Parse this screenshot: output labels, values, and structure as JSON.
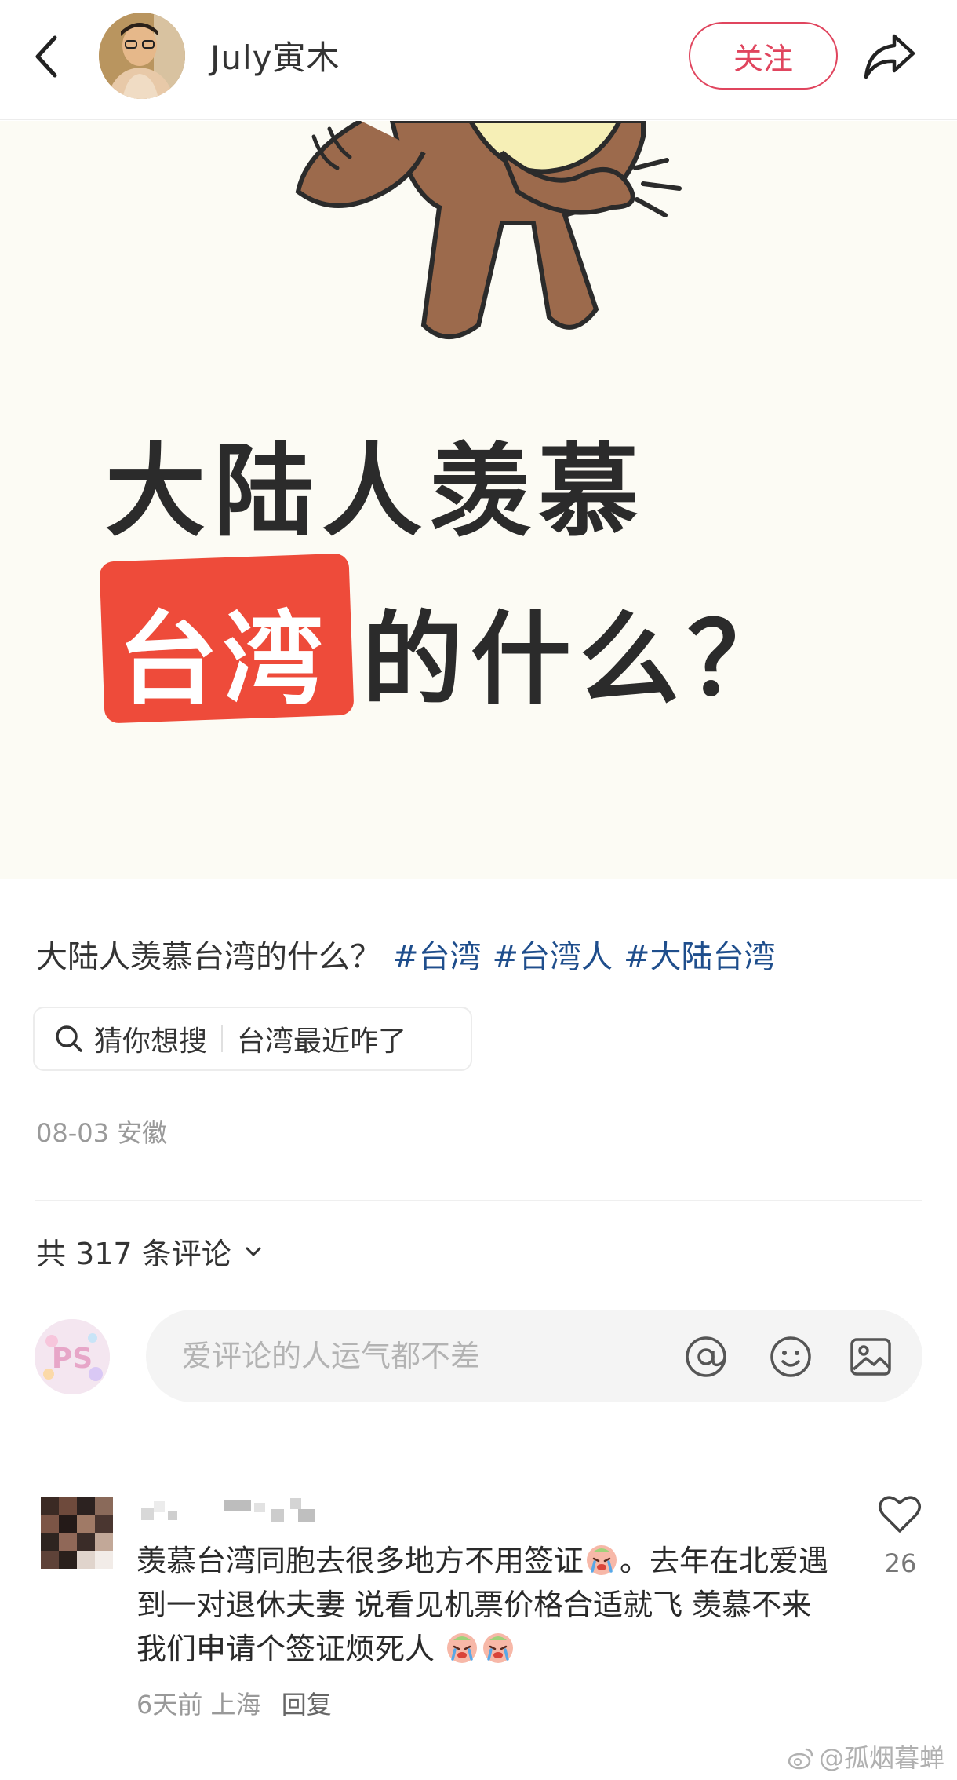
{
  "header": {
    "author_name": "July寅木",
    "follow_label": "关注"
  },
  "cover": {
    "line1": "大陆人羡慕",
    "highlight": "台湾",
    "line2_rest": "的什么？"
  },
  "post": {
    "title": "大陆人羡慕台湾的什么？",
    "tags": [
      "#台湾",
      "#台湾人",
      "#大陆台湾"
    ],
    "search_chip": {
      "label": "猜你想搜",
      "query": "台湾最近咋了"
    },
    "meta": "08-03 安徽"
  },
  "comments": {
    "count_label": "共 317 条评论",
    "input_placeholder": "爱评论的人运气都不差",
    "items": [
      {
        "body_1": "羡慕台湾同胞去很多地方不用签证",
        "body_2": "。去年在北爱遇到一对退休夫妻 说看见机票价格合适就飞 羡慕不来 我们申请个签证烦死人 ",
        "time": "6天前",
        "location": "上海",
        "reply_label": "回复",
        "likes": "26"
      }
    ]
  },
  "watermark": "@孤烟暮蝉",
  "colors": {
    "accent": "#e0455e",
    "tag": "#1f4e8c",
    "highlight": "#ee4b3a",
    "cover_bg": "#fcfbf4"
  }
}
